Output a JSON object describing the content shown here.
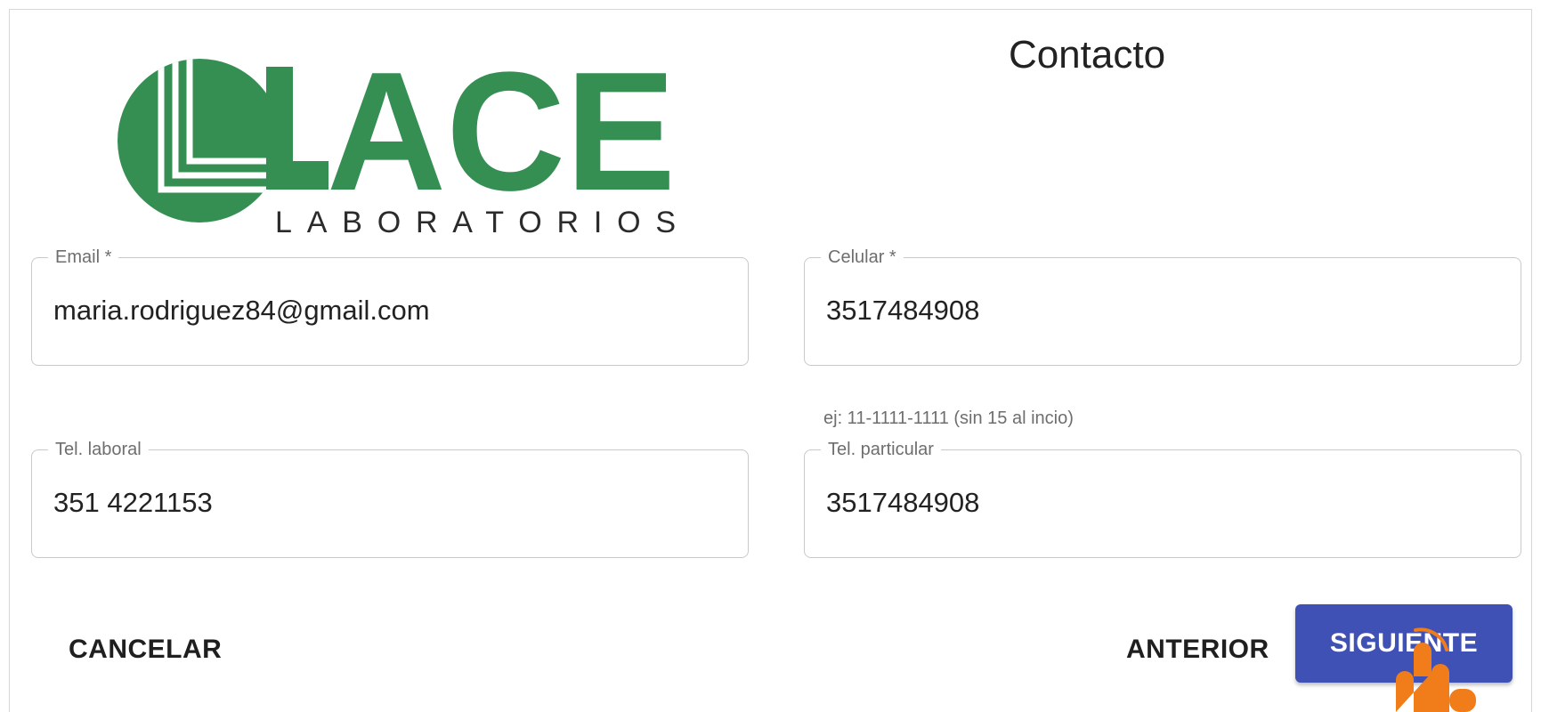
{
  "logo": {
    "name": "LACE",
    "tagline": "LABORATORIOS",
    "color": "#358f53"
  },
  "page_title": "Contacto",
  "form": {
    "email": {
      "label": "Email *",
      "value": "maria.rodriguez84@gmail.com"
    },
    "celular": {
      "label": "Celular *",
      "value": "3517484908",
      "helper": "ej: 11-1111-1111 (sin 15 al incio)"
    },
    "tel_laboral": {
      "label": "Tel. laboral",
      "value": "351 4221153"
    },
    "tel_particular": {
      "label": "Tel. particular",
      "value": "3517484908"
    }
  },
  "actions": {
    "cancel": "CANCELAR",
    "previous": "ANTERIOR",
    "next": "SIGUIENTE"
  },
  "colors": {
    "primary": "#3f51b5",
    "cursor": "#f07d1a"
  },
  "cursor_icon": "hand-pointer-icon"
}
